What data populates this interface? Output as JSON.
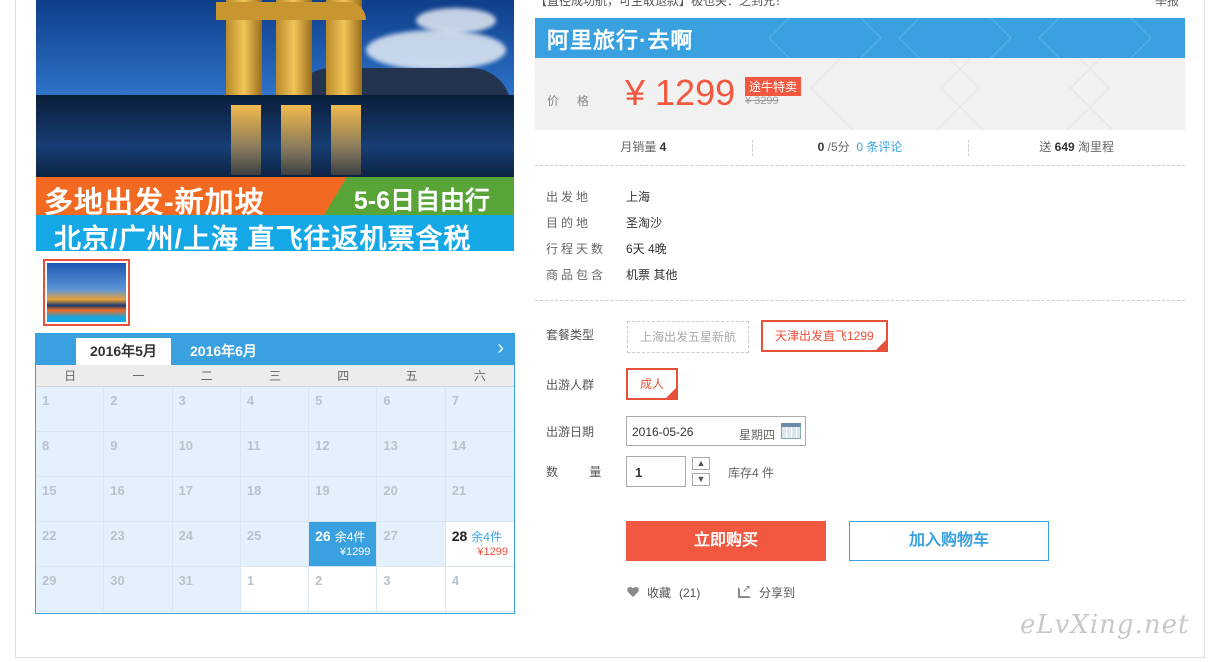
{
  "breadcrumb": "【直径成功航，可生取退款】极也关：之到兄！",
  "report_label": "举报",
  "hero": {
    "line1": "多地出发-新加坡",
    "line2": "5-6日自由行",
    "line3": "北京/广州/上海  直飞往返机票含税"
  },
  "calendar": {
    "tabs": [
      "2016年5月",
      "2016年6月"
    ],
    "next_icon": "chevron-right-icon",
    "weekdays": [
      "日",
      "一",
      "二",
      "三",
      "四",
      "五",
      "六"
    ],
    "cells": [
      {
        "d": "1"
      },
      {
        "d": "2"
      },
      {
        "d": "3"
      },
      {
        "d": "4"
      },
      {
        "d": "5"
      },
      {
        "d": "6"
      },
      {
        "d": "7"
      },
      {
        "d": "8"
      },
      {
        "d": "9"
      },
      {
        "d": "10"
      },
      {
        "d": "11"
      },
      {
        "d": "12"
      },
      {
        "d": "13"
      },
      {
        "d": "14"
      },
      {
        "d": "15"
      },
      {
        "d": "16"
      },
      {
        "d": "17"
      },
      {
        "d": "18"
      },
      {
        "d": "19"
      },
      {
        "d": "20"
      },
      {
        "d": "21"
      },
      {
        "d": "22"
      },
      {
        "d": "23"
      },
      {
        "d": "24"
      },
      {
        "d": "25"
      },
      {
        "d": "26",
        "stock": "余4件",
        "price": "¥1299",
        "state": "sel"
      },
      {
        "d": "27"
      },
      {
        "d": "28",
        "stock": "余4件",
        "price": "¥1299",
        "state": "avail"
      },
      {
        "d": "29"
      },
      {
        "d": "30"
      },
      {
        "d": "31"
      },
      {
        "d": "1",
        "state": "next"
      },
      {
        "d": "2",
        "state": "next"
      },
      {
        "d": "3",
        "state": "next"
      },
      {
        "d": "4",
        "state": "next"
      }
    ]
  },
  "shop": {
    "title": "阿里旅行·去啊"
  },
  "price": {
    "label": "价格",
    "value": "¥ 1299",
    "promo": "途牛特卖",
    "original": "¥ 3299"
  },
  "stats": {
    "monthly_label": "月销量",
    "monthly_value": "4",
    "rating_value": "0",
    "rating_suffix": "/5分",
    "reviews_link": "0 条评论",
    "points_prefix": "送",
    "points_value": "649",
    "points_suffix": "淘里程"
  },
  "info": [
    {
      "k": "出发地",
      "v": "上海"
    },
    {
      "k": "目的地",
      "v": "圣淘沙"
    },
    {
      "k": "行程天数",
      "v": "6天 4晚"
    },
    {
      "k": "商品包含",
      "v": "机票  其他"
    }
  ],
  "options": {
    "package_label": "套餐类型",
    "package_a": "上海出发五星新航",
    "package_b": "天津出发直飞1299",
    "crowd_label": "出游人群",
    "crowd_value": "成人",
    "date_label": "出游日期",
    "date_value": "2016-05-26",
    "date_weekday": "星期四",
    "qty_label": "数  量",
    "qty_value": "1",
    "stock_note": "库存4 件"
  },
  "actions": {
    "buy": "立即购买",
    "cart": "加入购物车",
    "favorite": "收藏",
    "favorite_count": "(21)",
    "share": "分享到"
  },
  "watermark": "eLvXing.net",
  "colors": {
    "accent": "#3aa1e0",
    "price": "#f2573f"
  }
}
